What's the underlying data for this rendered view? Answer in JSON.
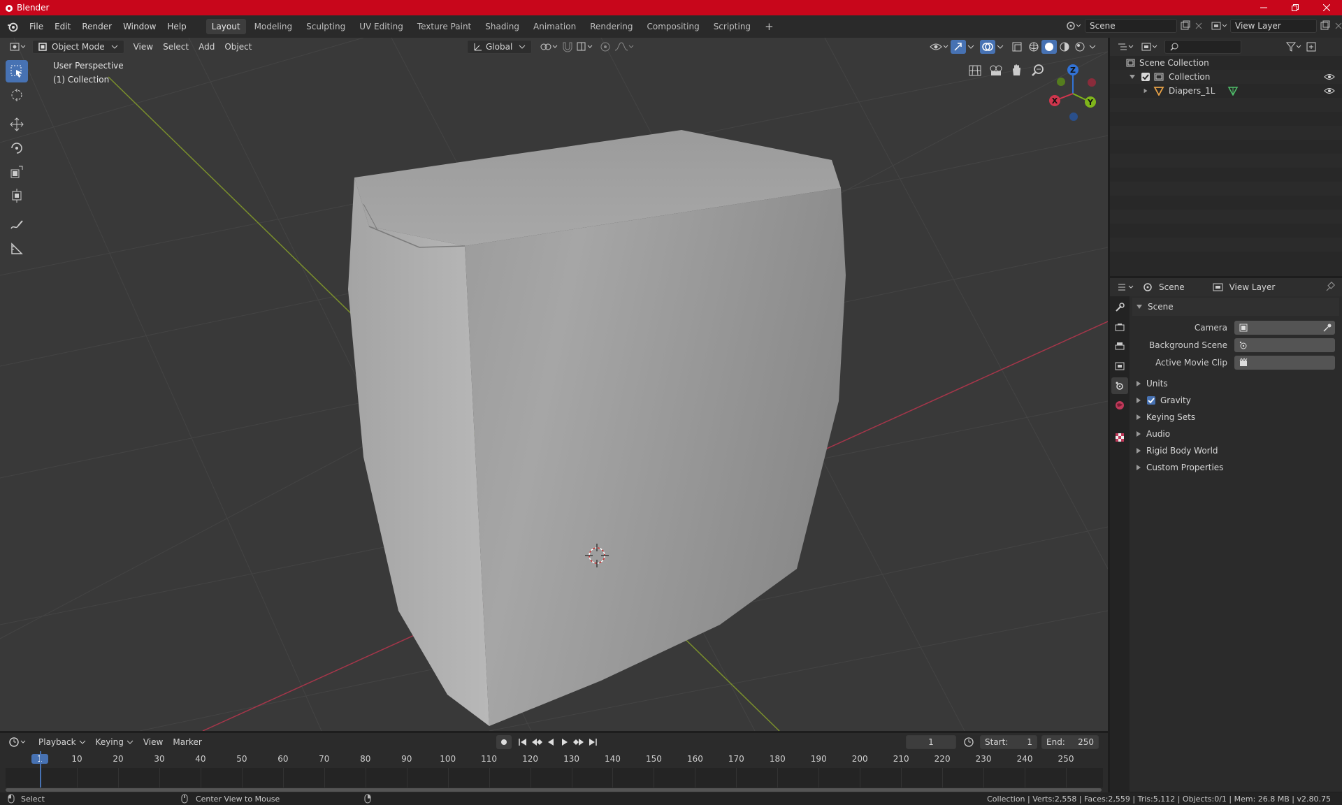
{
  "window": {
    "title": "Blender",
    "controls": [
      "minimize",
      "restore",
      "close"
    ]
  },
  "menubar": {
    "items": [
      "File",
      "Edit",
      "Render",
      "Window",
      "Help"
    ]
  },
  "workspaces": {
    "tabs": [
      {
        "label": "Layout",
        "active": true
      },
      {
        "label": "Modeling",
        "active": false
      },
      {
        "label": "Sculpting",
        "active": false
      },
      {
        "label": "UV Editing",
        "active": false
      },
      {
        "label": "Texture Paint",
        "active": false
      },
      {
        "label": "Shading",
        "active": false
      },
      {
        "label": "Animation",
        "active": false
      },
      {
        "label": "Rendering",
        "active": false
      },
      {
        "label": "Compositing",
        "active": false
      },
      {
        "label": "Scripting",
        "active": false
      }
    ],
    "add_label": "+"
  },
  "scene_selector": {
    "value": "Scene"
  },
  "view_layer_selector": {
    "value": "View Layer"
  },
  "viewport": {
    "mode": "Object Mode",
    "menus": [
      "View",
      "Select",
      "Add",
      "Object"
    ],
    "transform_orientation": "Global",
    "info_line1": "User Perspective",
    "info_line2": "(1) Collection",
    "gizmo_axes": {
      "x": "X",
      "y": "Y",
      "z": "Z"
    }
  },
  "outliner": {
    "root": "Scene Collection",
    "collection": "Collection",
    "object": "Diapers_1L"
  },
  "properties": {
    "tab_scene": "Scene",
    "tab_view_layer": "View Layer",
    "section_title": "Scene",
    "fields": [
      {
        "label": "Camera"
      },
      {
        "label": "Background Scene"
      },
      {
        "label": "Active Movie Clip"
      }
    ],
    "subsections": [
      {
        "label": "Units",
        "checkbox": false
      },
      {
        "label": "Gravity",
        "checkbox": true
      },
      {
        "label": "Keying Sets",
        "checkbox": false
      },
      {
        "label": "Audio",
        "checkbox": false
      },
      {
        "label": "Rigid Body World",
        "checkbox": false
      },
      {
        "label": "Custom Properties",
        "checkbox": false
      }
    ]
  },
  "timeline": {
    "menus": [
      "Playback",
      "Keying",
      "View",
      "Marker"
    ],
    "current_frame": "1",
    "start_label": "Start:",
    "start_value": "1",
    "end_label": "End:",
    "end_value": "250",
    "ruler_labels": [
      "1",
      "10",
      "20",
      "30",
      "40",
      "50",
      "60",
      "70",
      "80",
      "90",
      "100",
      "110",
      "120",
      "130",
      "140",
      "150",
      "160",
      "170",
      "180",
      "190",
      "200",
      "210",
      "220",
      "230",
      "240",
      "250"
    ]
  },
  "statusbar": {
    "left_action": "Select",
    "middle_action": "Center View to Mouse",
    "stats": "Collection | Verts:2,558 | Faces:2,559 | Tris:5,112 | Objects:0/1 | Mem: 26.8 MB | v2.80.75"
  },
  "colors": {
    "title_bar": "#c8061b",
    "accent": "#4772b3",
    "x_axis": "#d0364d",
    "y_axis": "#7fb51b",
    "z_axis": "#3273d6",
    "object_orange": "#e8a247",
    "mesh_green": "#4fbf6a"
  }
}
